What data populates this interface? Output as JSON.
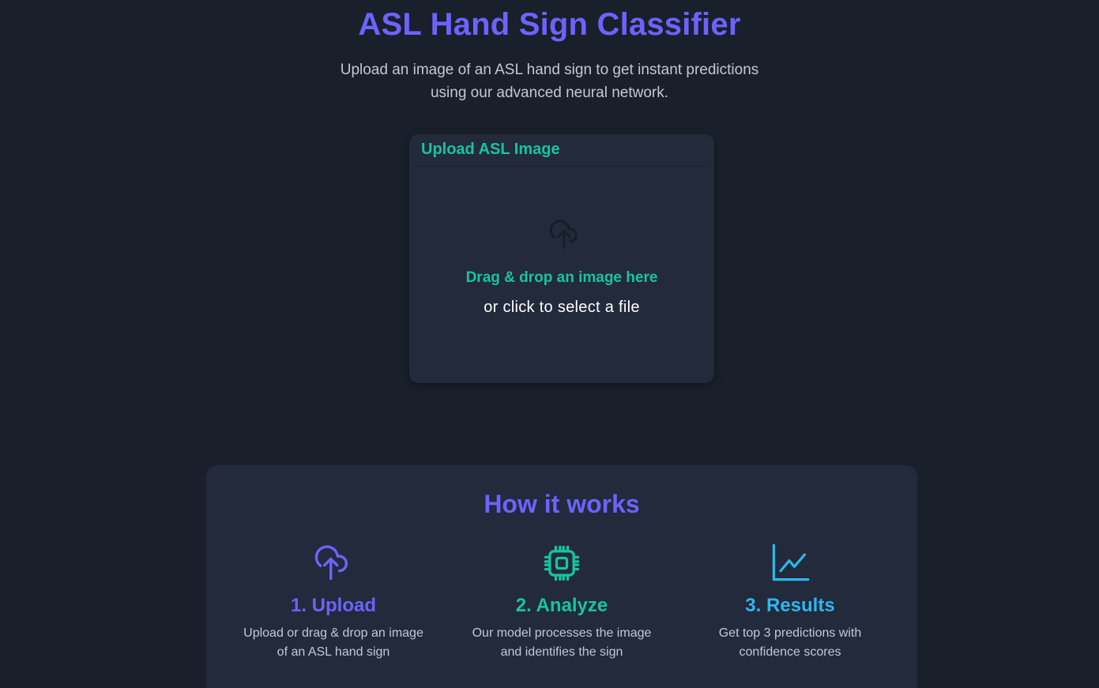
{
  "header": {
    "title": "ASL Hand Sign Classifier",
    "subtitle_line1": "Upload an image of an ASL hand sign to get instant predictions",
    "subtitle_line2": "using our advanced neural network."
  },
  "upload": {
    "card_title": "Upload ASL Image",
    "icon": "cloud-upload-icon",
    "drop_title": "Drag & drop an image here",
    "drop_sub": "or click to select a file"
  },
  "how": {
    "title": "How it works",
    "steps": [
      {
        "icon": "cloud-upload-icon",
        "title": "1. Upload",
        "desc_line1": "Upload or drag & drop an image",
        "desc_line2": "of an ASL hand sign",
        "color": "#6c63ff"
      },
      {
        "icon": "cpu-chip-icon",
        "title": "2. Analyze",
        "desc_line1": "Our model processes the image",
        "desc_line2": "and identifies the sign",
        "color": "#17c59b"
      },
      {
        "icon": "line-chart-icon",
        "title": "3. Results",
        "desc_line1": "Get top 3 predictions with",
        "desc_line2": "confidence scores",
        "color": "#2fb6ec"
      }
    ]
  },
  "colors": {
    "background": "#1a1f2c",
    "card": "#222a3c",
    "primary": "#6c63ff",
    "accent": "#17c59b",
    "info": "#2fb6ec",
    "muted_text": "#c3c8d2"
  }
}
